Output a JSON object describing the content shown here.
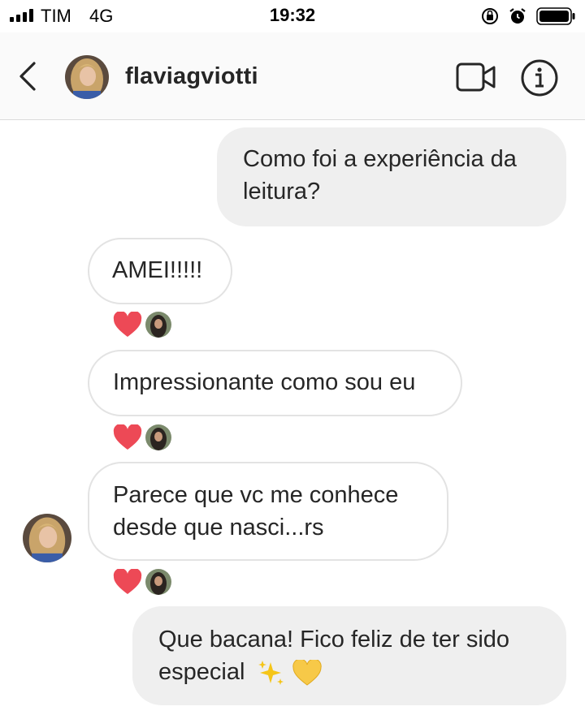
{
  "status_bar": {
    "carrier": "TIM",
    "network": "4G",
    "time": "19:32"
  },
  "header": {
    "username": "flaviagviotti"
  },
  "messages": [
    {
      "direction": "outgoing",
      "text": "Como foi a experiência da leitura?"
    },
    {
      "direction": "incoming",
      "text": "AMEI!!!!!",
      "reaction": "red-heart"
    },
    {
      "direction": "incoming",
      "text": "Impressionante como sou eu",
      "reaction": "red-heart"
    },
    {
      "direction": "incoming",
      "text": "Parece que vc me conhece desde que nasci...rs",
      "reaction": "red-heart"
    },
    {
      "direction": "outgoing",
      "text": "Que bacana! Fico feliz de ter sido especial",
      "emojis": [
        "sparkles-icon",
        "yellow-heart-icon"
      ]
    }
  ],
  "colors": {
    "outgoing_bubble": "#efefef",
    "incoming_border": "#e3e3e3",
    "heart": "#ed4956",
    "yellow_heart": "#f7c948",
    "sparkles": "#f5c518"
  }
}
